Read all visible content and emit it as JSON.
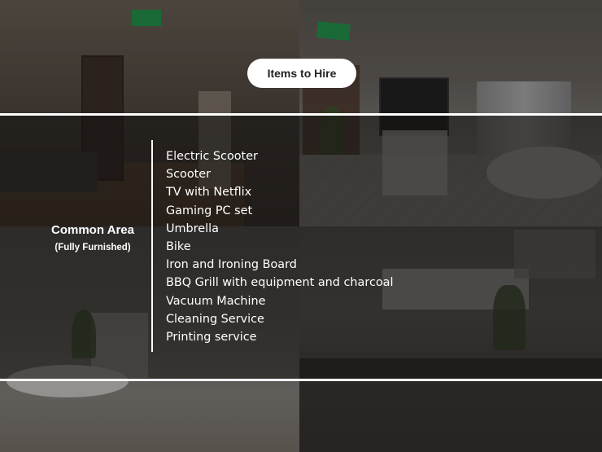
{
  "button": {
    "label": "Items to Hire"
  },
  "area": {
    "title": "Common Area",
    "subtitle": "(Fully Furnished)"
  },
  "items": [
    "Electric Scooter",
    "Scooter",
    "TV with Netflix",
    "Gaming PC set",
    "Umbrella",
    "Bike",
    "Iron and Ironing Board",
    "BBQ Grill with equipment and charcoal",
    "Vacuum Machine",
    "Cleaning Service",
    "Printing service"
  ],
  "colors": {
    "overlay": "#161412",
    "text": "#ffffff",
    "pill_bg": "#ffffff",
    "pill_text": "#222222",
    "exit_sign": "#1c9a4b"
  }
}
